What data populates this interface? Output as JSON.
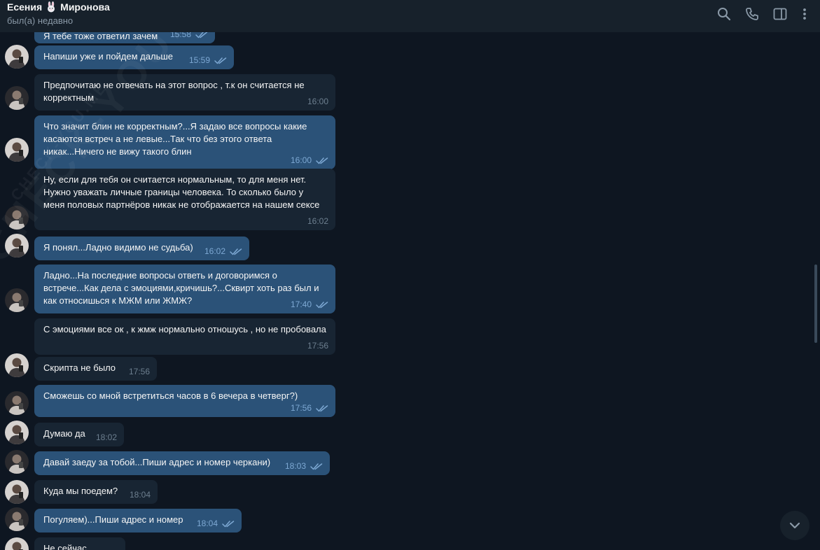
{
  "header": {
    "name_first": "Есения",
    "name_last": "Миронова",
    "status": "был(а) недавно",
    "icons": [
      "search-icon",
      "phone-icon",
      "sidebar-toggle-icon",
      "more-vertical-icon"
    ]
  },
  "watermark": "CHECK-YOU.ME",
  "messages": [
    {
      "dir": "out",
      "text": "Я тебе тоже ответил зачем",
      "time": "15:58"
    },
    {
      "dir": "out",
      "text": "Напиши уже и пойдем дальше",
      "time": "15:59"
    },
    {
      "dir": "in",
      "text": "Предпочитаю не отвечать на этот вопрос , т.к он считается не корректным",
      "time": "16:00"
    },
    {
      "dir": "out",
      "text": "Что значит блин не корректным?...Я задаю все вопросы какие касаются встреч а не левые...Так что без этого ответа никак...Ничего не вижу такого блин",
      "time": "16:00"
    },
    {
      "dir": "in",
      "text": "Ну, если для тебя он считается нормальным, то для меня нет. Нужно уважать личные границы человека. То сколько было у меня половых партнёров никак не отображается на нашем сексе",
      "time": "16:02"
    },
    {
      "dir": "out",
      "text": "Я понял...Ладно видимо не судьба)",
      "time": "16:02"
    },
    {
      "dir": "out",
      "text": "Ладно...На последние вопросы ответь и договоримся о встрече...Как дела с эмоциями,кричишь?...Сквирт хоть раз был и как относишься к МЖМ или ЖМЖ?",
      "time": "17:40"
    },
    {
      "dir": "in",
      "text": "С эмоциями все ок , к жмж нормально отношусь , но не пробовала",
      "time": "17:56"
    },
    {
      "dir": "in",
      "text": "Скрипта не было",
      "time": "17:56"
    },
    {
      "dir": "out",
      "text": "Сможешь со мной встретиться часов в 6 вечера в четверг?)",
      "time": "17:56"
    },
    {
      "dir": "in",
      "text": "Думаю да",
      "time": "18:02"
    },
    {
      "dir": "out",
      "text": "Давай заеду за тобой...Пиши адрес и номер черкани)",
      "time": "18:03"
    },
    {
      "dir": "in",
      "text": "Куда мы поедем?",
      "time": "18:04"
    },
    {
      "dir": "out",
      "text": "Погуляем)...Пиши адрес и номер",
      "time": "18:04"
    },
    {
      "dir": "in",
      "text": "Не сейчас",
      "time": ""
    }
  ],
  "colors": {
    "background": "#0e1621",
    "header": "#17212b",
    "incoming_bubble": "#182533",
    "outgoing_bubble": "#2b5278",
    "read_checks": "#7da8d3"
  }
}
